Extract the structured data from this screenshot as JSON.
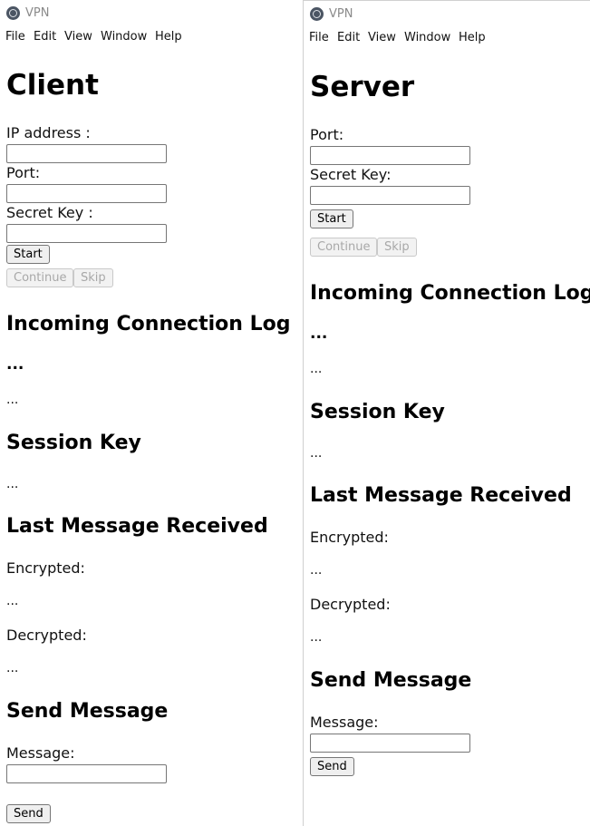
{
  "client_window": {
    "title": "VPN",
    "menu": [
      "File",
      "Edit",
      "View",
      "Window",
      "Help"
    ],
    "heading": "Client",
    "ip_label": "IP address :",
    "ip_value": "",
    "port_label": "Port:",
    "port_value": "",
    "secret_label": "Secret Key :",
    "secret_value": "",
    "start_button": "Start",
    "continue_button": "Continue",
    "skip_button": "Skip",
    "log_heading": "Incoming Connection Log",
    "log_bold": "...",
    "log_text": "...",
    "session_heading": "Session Key",
    "session_value": "...",
    "last_heading": "Last Message Received",
    "encrypted_label": "Encrypted:",
    "encrypted_value": "...",
    "decrypted_label": "Decrypted:",
    "decrypted_value": "...",
    "send_heading": "Send Message",
    "message_label": "Message:",
    "message_value": "",
    "send_button": "Send"
  },
  "server_window": {
    "title": "VPN",
    "menu": [
      "File",
      "Edit",
      "View",
      "Window",
      "Help"
    ],
    "heading": "Server",
    "port_label": "Port:",
    "port_value": "",
    "secret_label": "Secret Key:",
    "secret_value": "",
    "start_button": "Start",
    "continue_button": "Continue",
    "skip_button": "Skip",
    "log_heading": "Incoming Connection Log",
    "log_bold": "...",
    "log_text": "...",
    "session_heading": "Session Key",
    "session_value": "...",
    "last_heading": "Last Message Received",
    "encrypted_label": "Encrypted:",
    "encrypted_value": "...",
    "decrypted_label": "Decrypted:",
    "decrypted_value": "...",
    "send_heading": "Send Message",
    "message_label": "Message:",
    "message_value": "",
    "send_button": "Send"
  }
}
